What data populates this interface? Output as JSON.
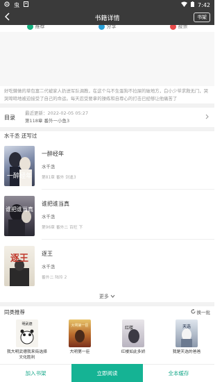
{
  "status_bar": {
    "left_icons": [
      "settings-icon",
      "cat-app-icon",
      "notification-icon"
    ],
    "cat_label": "虫",
    "time": "7:42"
  },
  "header": {
    "title": "书籍详情",
    "shelf_button": "书架"
  },
  "actions": [
    {
      "label": "推荐",
      "color": "#14b07f"
    },
    {
      "label": "分享",
      "color": "#2aa0d8"
    },
    {
      "label": "投票",
      "color": "#e84a4a"
    }
  ],
  "summary": "好吃懒做的草包富二代被家人扔进军队调教，在这个乌不生蛋狗不拉屎的破地方，白小少爷求救无门，哭哭啼啼地被迫接受了自己的命运。每天忍受要拿的操练和自尊心的打击已经够让他痛苦了",
  "catalog": {
    "label": "目录",
    "update_text": "最近更新：2022-02-05 05:27",
    "latest_chapter": "第118章 番外一小鱼3"
  },
  "author_section": {
    "heading": "水千丞  还写过",
    "books": [
      {
        "title": "一醉经年",
        "author": "水千丞",
        "meta": "第81章 番外 剑逢3",
        "cover_text": "一醉经年"
      },
      {
        "title": "谁把谁当真",
        "author": "水千丞",
        "meta": "第96章 番外二 百旺 下",
        "cover_text": "谁把谁当真"
      },
      {
        "title": "逐王",
        "author": "水千丞",
        "meta": "番外二 陆玲 2",
        "cover_text": "逐王"
      }
    ],
    "more_label": "更多"
  },
  "recommend": {
    "heading": "同类推荐",
    "swap_label": "换一批",
    "items": [
      {
        "name": "我大明武德我来街选择文化胜利",
        "cover_text": "明武德"
      },
      {
        "name": "大明第一臣",
        "cover_text": "大明第一臣"
      },
      {
        "name": "红楼如此多娇",
        "cover_text": "红楼"
      },
      {
        "name": "我是天选的爸爸",
        "cover_text": "天选"
      }
    ]
  },
  "bottom_bar": {
    "add_shelf": "加入书架",
    "read_now": "立即阅读",
    "cache_all": "全本缓存"
  }
}
